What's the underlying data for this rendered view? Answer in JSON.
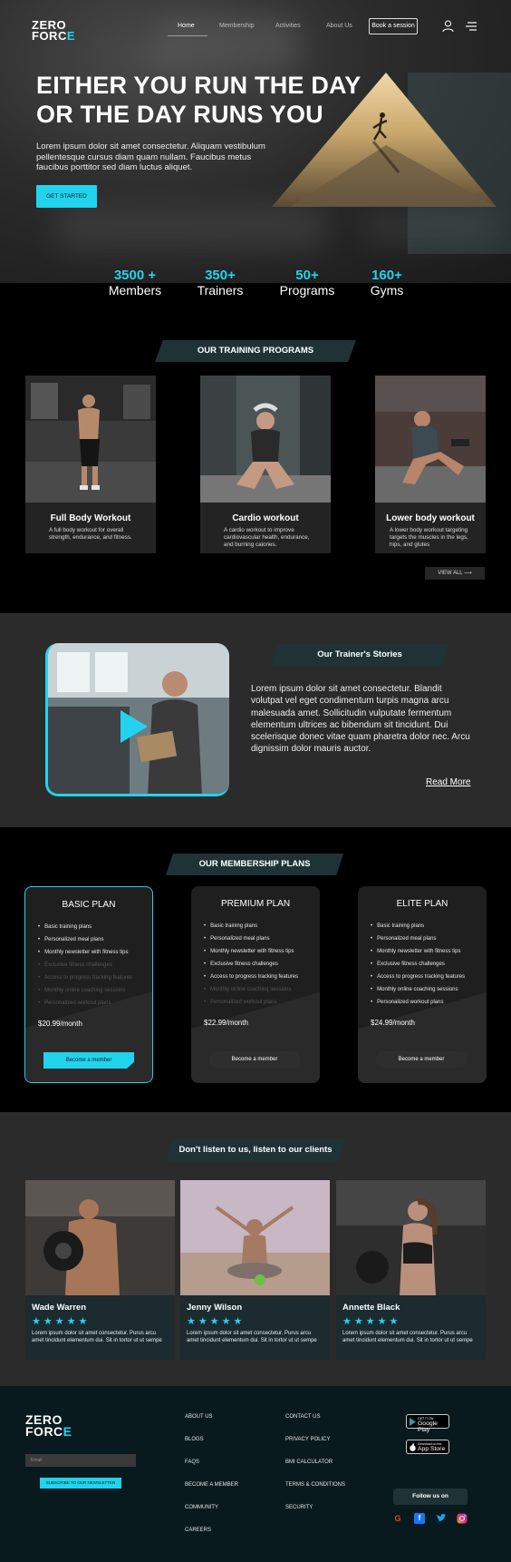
{
  "brand": {
    "line1": "ZERO",
    "line2_a": "FORC",
    "line2_b": "E"
  },
  "nav": {
    "items": [
      "Home",
      "Membership",
      "Activities",
      "About Us"
    ],
    "book": "Book a session"
  },
  "hero": {
    "headline": "EITHER YOU RUN THE DAY OR THE DAY RUNS YOU",
    "lead": "Lorem ipsum dolor sit amet consectetur. Aliquam vestibulum pellentesque cursus diam quam nullam. Faucibus metus faucibus porttitor sed diam luctus aliquet.",
    "cta": "GET STARTED"
  },
  "stats": [
    {
      "num": "3500 +",
      "label": "Members"
    },
    {
      "num": "350+",
      "label": "Trainers"
    },
    {
      "num": "50+",
      "label": "Programs"
    },
    {
      "num": "160+",
      "label": "Gyms"
    }
  ],
  "programs": {
    "heading": "OUR TRAINING PROGRAMS",
    "cards": [
      {
        "title": "Full Body Workout",
        "desc": "A full body workout for overall strength, endurance, and fitness."
      },
      {
        "title": "Cardio workout",
        "desc": "A cardio workout to  improve cardiovascular health, endurance, and burning calories."
      },
      {
        "title": "Lower body workout",
        "desc": "A lower body workout targeting targets the muscles in the legs, hips, and glutes"
      }
    ],
    "view_all": "VIEW ALL"
  },
  "trainer": {
    "heading": "Our Trainer's Stories",
    "text": "Lorem ipsum dolor sit amet consectetur. Blandit volutpat vel eget condimentum turpis magna arcu malesuada amet. Sollicitudin vulputate fermentum elementum ultrices ac bibendum sit tincidunt. Dui scelerisque donec vitae quam pharetra dolor nec. Arcu dignissim dolor mauris auctor.",
    "read_more": "Read More"
  },
  "membership": {
    "heading": "OUR MEMBERSHIP PLANS",
    "plans": [
      {
        "name": "BASIC PLAN",
        "price": "$20.99/month",
        "button": "Become a member",
        "features": [
          "Basic training plans",
          "Personalized meal plans",
          "Monthly newsletter with fitness tips",
          "Exclusive fitness challenges",
          "Access to progress tracking features",
          "Monthly online coaching sessions",
          "Personalized workout plans"
        ]
      },
      {
        "name": "PREMIUM PLAN",
        "price": "$22.99/month",
        "button": "Become a member",
        "features": [
          "Basic training plans",
          "Personalized meal plans",
          "Monthly newsletter with fitness tips",
          "Exclusive fitness challenges",
          "Access to progress tracking features",
          "Monthly online coaching sessions",
          "Personalized workout plans"
        ]
      },
      {
        "name": "ELITE PLAN",
        "price": "$24.99/month",
        "button": "Become a member",
        "features": [
          "Basic training plans",
          "Personalized meal plans",
          "Monthly newsletter with fitness tips",
          "Exclusive fitness challenges",
          "Access to progress tracking features",
          "Monthly online coaching sessions",
          "Personalized workout plans"
        ]
      }
    ]
  },
  "testimonials": {
    "heading": "Don't listen to us, listen to our clients",
    "items": [
      {
        "name": "Wade Warren",
        "stars": "★★★★★",
        "text": "Lorem ipsum dolor sit amet consectetur. Purus arcu amet tincidunt elementum dui. Sit in tortor ut ut sempe"
      },
      {
        "name": "Jenny Wilson",
        "stars": "★★★★★",
        "text": "Lorem ipsum dolor sit amet consectetur. Purus arcu amet tincidunt elementum dui. Sit in tortor ut ut sempe"
      },
      {
        "name": "Annette Black",
        "stars": "★★★★★",
        "text": "Lorem ipsum dolor sit amet consectetur. Purus arcu amet tincidunt elementum dui. Sit in tortor ut ut sempe"
      }
    ]
  },
  "footer": {
    "email_placeholder": "Email",
    "subscribe": "SUBSCRIBE TO OUR NEWSLETTER",
    "col1": [
      "ABOUT US",
      "BLOGS",
      "FAQS",
      "BECOME A MEMBER",
      "COMMUNITY",
      "CAREERS"
    ],
    "col2": [
      "CONTACT US",
      "PRIVACY POLICY",
      "BMI CALCULATOR",
      "TERMS & CONDITIONS",
      "SECURITY"
    ],
    "google_small": "GET IT ON",
    "google_big": "Google Play",
    "apple_small": "Download on the",
    "apple_big": "App Store",
    "follow": "Follow us on"
  },
  "colors": {
    "accent": "#22d3ee",
    "dark_teal": "#1f3337",
    "footer_bg": "#081a1e"
  }
}
